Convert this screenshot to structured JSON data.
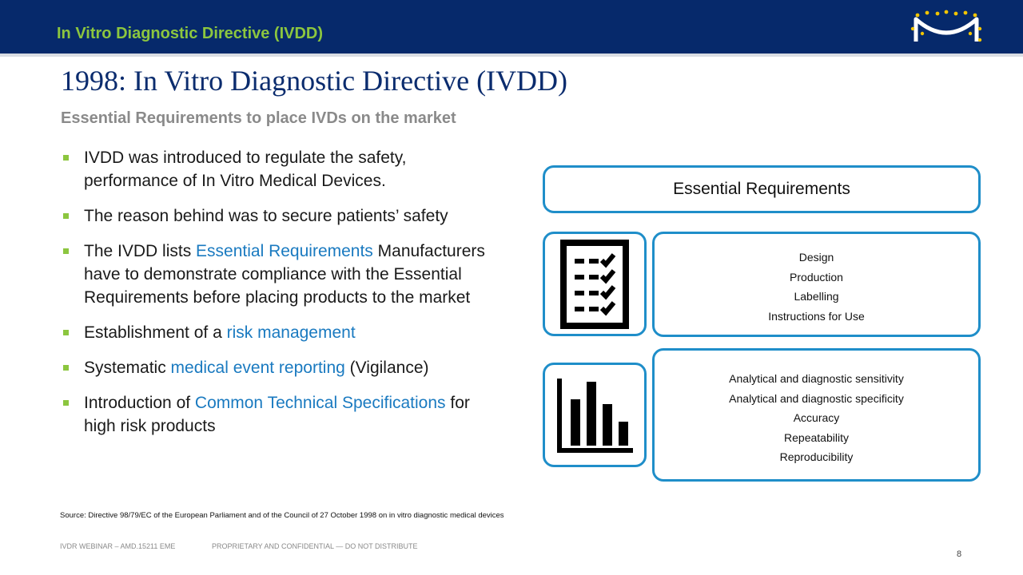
{
  "header": {
    "title": "In Vitro Diagnostic Directive (IVDD)"
  },
  "slide": {
    "title": "1998: In Vitro Diagnostic Directive (IVDD)",
    "subtitle": "Essential Requirements to place IVDs on the market"
  },
  "bullets": [
    {
      "segments": [
        {
          "text": "IVDD was introduced to regulate the safety, performance  of In Vitro Medical Devices.",
          "highlight": false
        }
      ]
    },
    {
      "segments": [
        {
          "text": "The reason behind was to secure patients’ safety",
          "highlight": false
        }
      ]
    },
    {
      "segments": [
        {
          "text": "The IVDD lists ",
          "highlight": false
        },
        {
          "text": "Essential Requirements",
          "highlight": true
        },
        {
          "text": " Manufacturers have to demonstrate compliance with the Essential Requirements before placing products to the market",
          "highlight": false
        }
      ]
    },
    {
      "segments": [
        {
          "text": "Establishment of a ",
          "highlight": false
        },
        {
          "text": "risk management",
          "highlight": true
        }
      ]
    },
    {
      "segments": [
        {
          "text": "Systematic ",
          "highlight": false
        },
        {
          "text": "medical event reporting",
          "highlight": true
        },
        {
          "text": " (Vigilance)",
          "highlight": false
        }
      ]
    },
    {
      "segments": [
        {
          "text": "Introduction of ",
          "highlight": false
        },
        {
          "text": "Common Technical Specifications",
          "highlight": true
        },
        {
          "text": " for high risk products",
          "highlight": false
        }
      ]
    }
  ],
  "essential_requirements": {
    "header": "Essential Requirements",
    "group1": {
      "icon": "checklist-icon",
      "items": [
        "Design",
        "Production",
        "Labelling",
        "Instructions for Use"
      ]
    },
    "group2": {
      "icon": "bar-chart-icon",
      "items": [
        "Analytical and diagnostic sensitivity",
        "Analytical and diagnostic specificity",
        "Accuracy",
        "Repeatability",
        "Reproducibility"
      ]
    }
  },
  "source": "Source: Directive 98/79/EC of the European Parliament and of the Council of 27 October 1998 on in vitro diagnostic medical devices",
  "footer": {
    "left": "IVDR WEBINAR – AMD.15211 EME",
    "middle": "PROPRIETARY AND CONFIDENTIAL — DO NOT DISTRIBUTE",
    "page": "8"
  },
  "colors": {
    "header_bar": "#06296b",
    "header_title": "#8cc63f",
    "slide_title": "#0b2c6e",
    "highlight": "#1a7ac0",
    "box_border": "#1f8ec9",
    "bullet_marker": "#8cc63f"
  }
}
